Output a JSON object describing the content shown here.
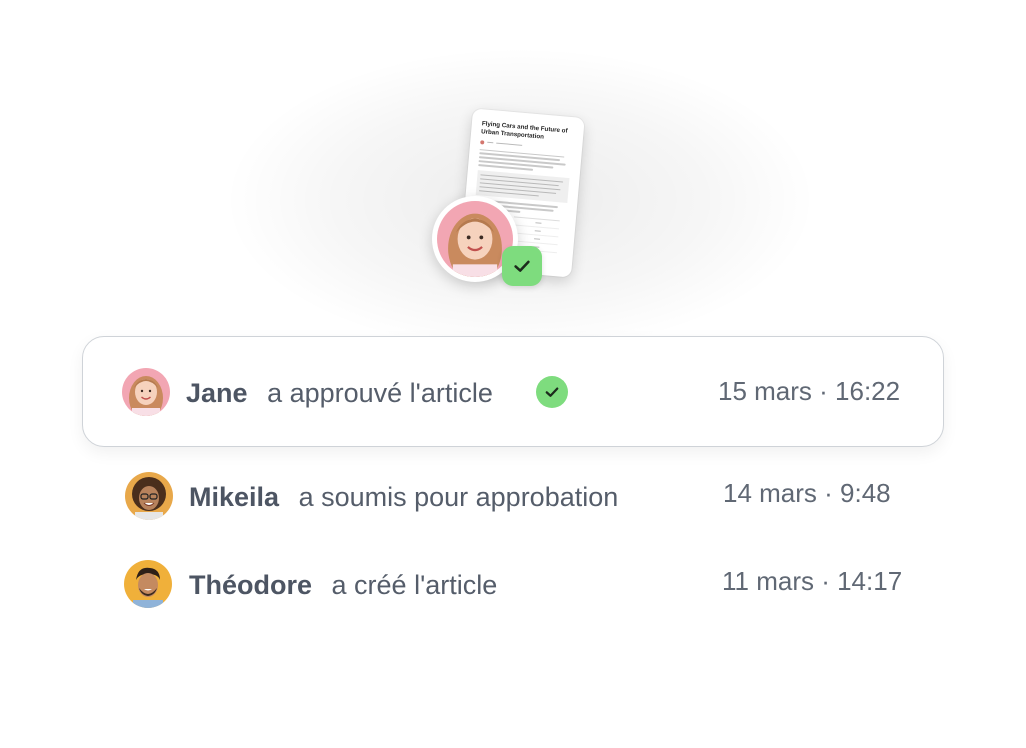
{
  "document": {
    "title": "Flying Cars and the Future of Urban Transportation"
  },
  "colors": {
    "approved_green": "#7edc7e",
    "text_primary": "#4d5563",
    "border": "#cfd3d8"
  },
  "activity": [
    {
      "name": "Jane",
      "action": "a approuvé l'article",
      "time": "15 mars · 16:22",
      "avatar": "jane-avatar",
      "approved_icon": "check-icon"
    },
    {
      "name": "Mikeila",
      "action": "a soumis pour approbation",
      "time": "14 mars · 9:48",
      "avatar": "mikeila-avatar"
    },
    {
      "name": "Théodore",
      "action": "a créé l'article",
      "time": "11 mars · 14:17",
      "avatar": "theodore-avatar"
    }
  ]
}
